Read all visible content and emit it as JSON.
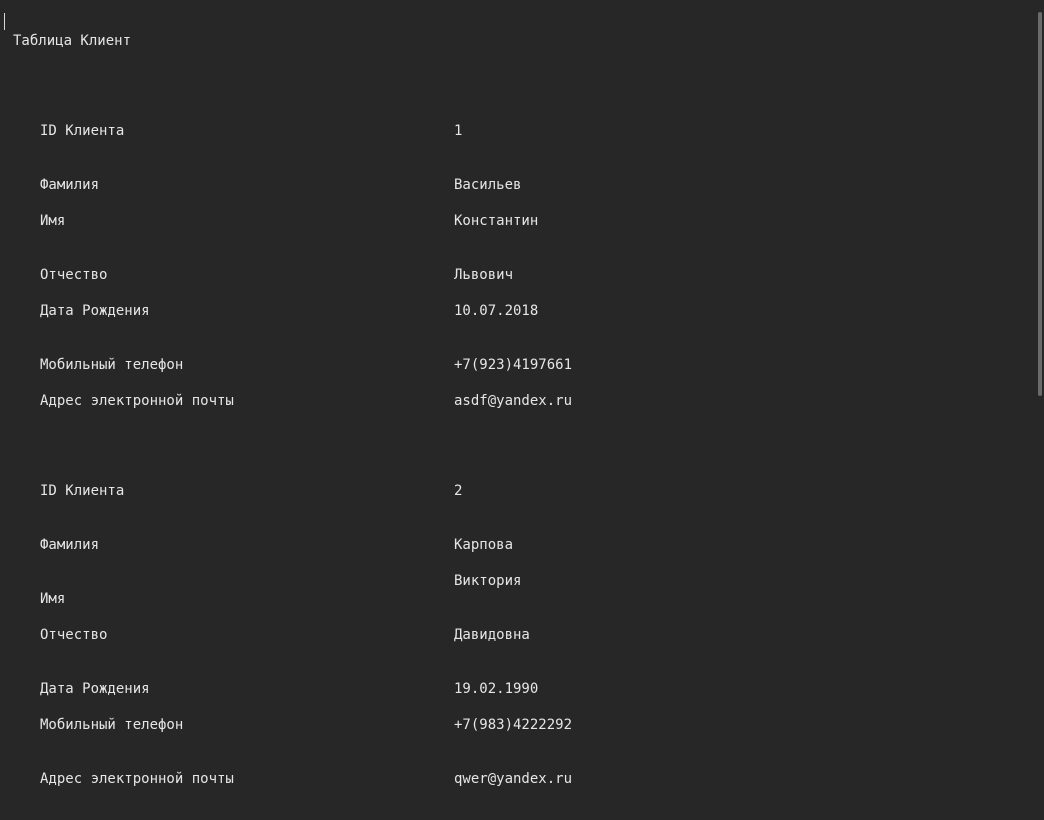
{
  "document": {
    "title": "Таблица Клиент",
    "records": [
      {
        "fields": [
          {
            "label": "ID Клиента",
            "value": "1"
          },
          {
            "label": "Фамилия",
            "value": "Васильев"
          },
          {
            "label": "Имя",
            "value": "Константин"
          },
          {
            "label": "Отчество",
            "value": "Львович"
          },
          {
            "label": "Дата Рождения",
            "value": "10.07.2018"
          },
          {
            "label": "Мобильный телефон",
            "value": "+7(923)4197661"
          },
          {
            "label": "Адрес электронной почты",
            "value": "asdf@yandex.ru"
          }
        ]
      },
      {
        "fields": [
          {
            "label": "ID Клиента",
            "value": "2"
          },
          {
            "label": "Фамилия",
            "value": "Карпова"
          },
          {
            "label": "Имя",
            "value": "Виктория"
          },
          {
            "label": "Отчество",
            "value": "Давидовна"
          },
          {
            "label": "Дата Рождения",
            "value": "19.02.1990"
          },
          {
            "label": "Мобильный телефон",
            "value": "+7(983)4222292"
          },
          {
            "label": "Адрес электронной почты",
            "value": "qwer@yandex.ru"
          }
        ]
      }
    ]
  },
  "colors": {
    "background": "#272727",
    "text": "#e6e6e6",
    "scrollbar_thumb": "#6a6a6a"
  }
}
